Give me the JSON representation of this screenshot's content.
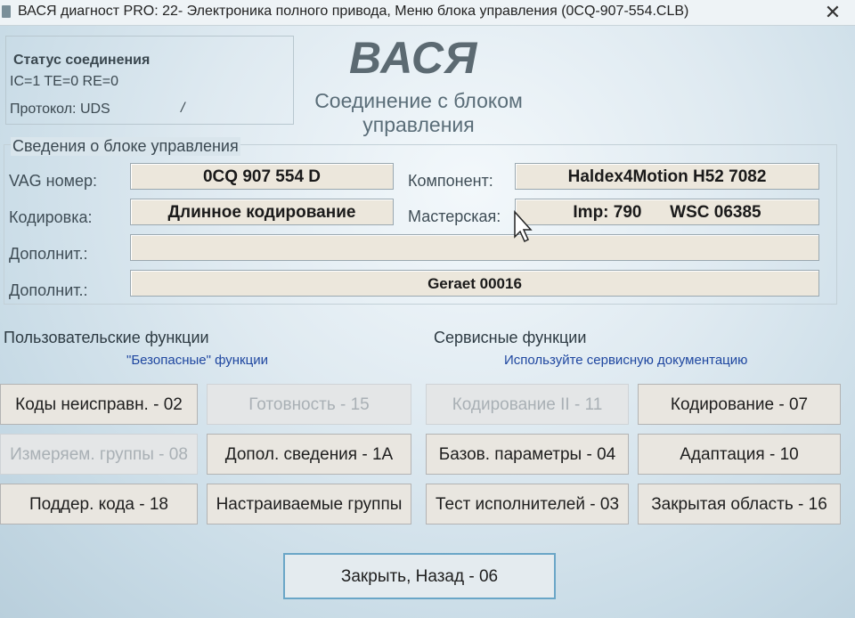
{
  "window": {
    "title": "ВАСЯ диагност PRO: 22- Электроника полного привода,  Меню блока управления (0CQ-907-554.CLB)",
    "close_symbol": "✕"
  },
  "status": {
    "label": "Статус соединения",
    "ic_line": "IC=1  TE=0   RE=0",
    "protocol": "Протокол: UDS",
    "spinner": "/"
  },
  "logo": "ВАСЯ",
  "connection_text": "Соединение с блоком управления",
  "info": {
    "title": "Сведения о блоке управления",
    "vag_label": "VAG номер:",
    "vag_value": "0CQ 907 554 D",
    "component_label": "Компонент:",
    "component_value": "Haldex4Motion H52 7082",
    "coding_label": "Кодировка:",
    "coding_value": "Длинное кодирование",
    "workshop_label": "Мастерская:",
    "workshop_value": "Imp: 790      WSC 06385",
    "extra1_label": "Дополнит.:",
    "extra1_value": "",
    "extra2_label": "Дополнит.:",
    "extra2_value": "Geraet 00016"
  },
  "user_functions": {
    "heading": "Пользовательские функции",
    "subheading": "\"Безопасные\" функции",
    "buttons": [
      {
        "label": "Коды неисправн. - 02",
        "enabled": true
      },
      {
        "label": "Готовность - 15",
        "enabled": false
      },
      {
        "label": "Измеряем. группы - 08",
        "enabled": false
      },
      {
        "label": "Допол. сведения - 1A",
        "enabled": true
      },
      {
        "label": "Поддер. кода - 18",
        "enabled": true
      },
      {
        "label": "Настраиваемые группы",
        "enabled": true
      }
    ]
  },
  "service_functions": {
    "heading": "Сервисные функции",
    "subheading": "Используйте сервисную документацию",
    "buttons": [
      {
        "label": "Кодирование II - 11",
        "enabled": false
      },
      {
        "label": "Кодирование - 07",
        "enabled": true
      },
      {
        "label": "Базов. параметры - 04",
        "enabled": true
      },
      {
        "label": "Адаптация - 10",
        "enabled": true
      },
      {
        "label": "Тест исполнителей - 03",
        "enabled": true
      },
      {
        "label": "Закрытая область - 16",
        "enabled": true
      }
    ]
  },
  "close_button": "Закрыть, Назад - 06"
}
